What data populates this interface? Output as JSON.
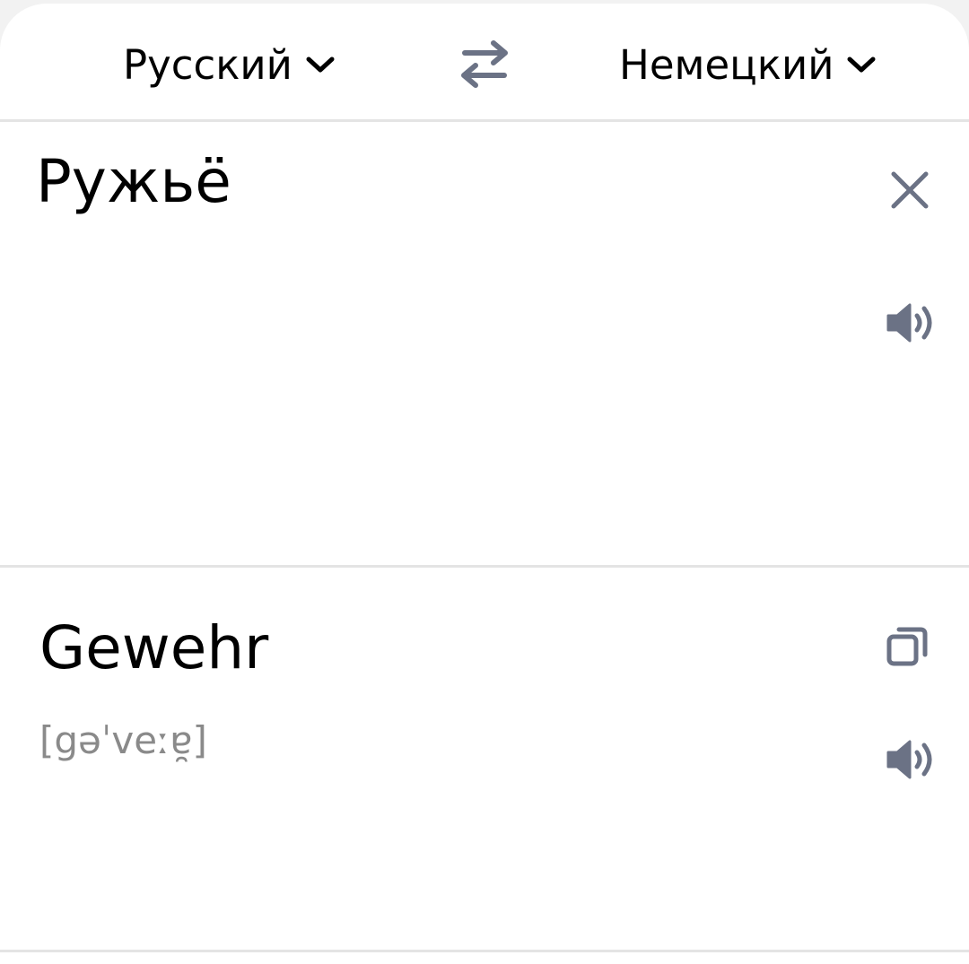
{
  "languages": {
    "source": "Русский",
    "target": "Немецкий"
  },
  "input": {
    "text": "Ружьё"
  },
  "output": {
    "translation": "Gewehr",
    "transcription": "[gəˈveːɐ̯]"
  },
  "icons": {
    "source_dropdown": "chevron-down-icon",
    "target_dropdown": "chevron-down-icon",
    "swap": "swap-arrows-icon",
    "clear": "close-icon",
    "speak_source": "speaker-icon",
    "copy": "copy-icon",
    "speak_translation": "speaker-icon"
  },
  "colors": {
    "icon_gray": "#6b7285",
    "text": "#000000",
    "transcription": "#8a8a8a",
    "divider": "#e4e4e4"
  }
}
